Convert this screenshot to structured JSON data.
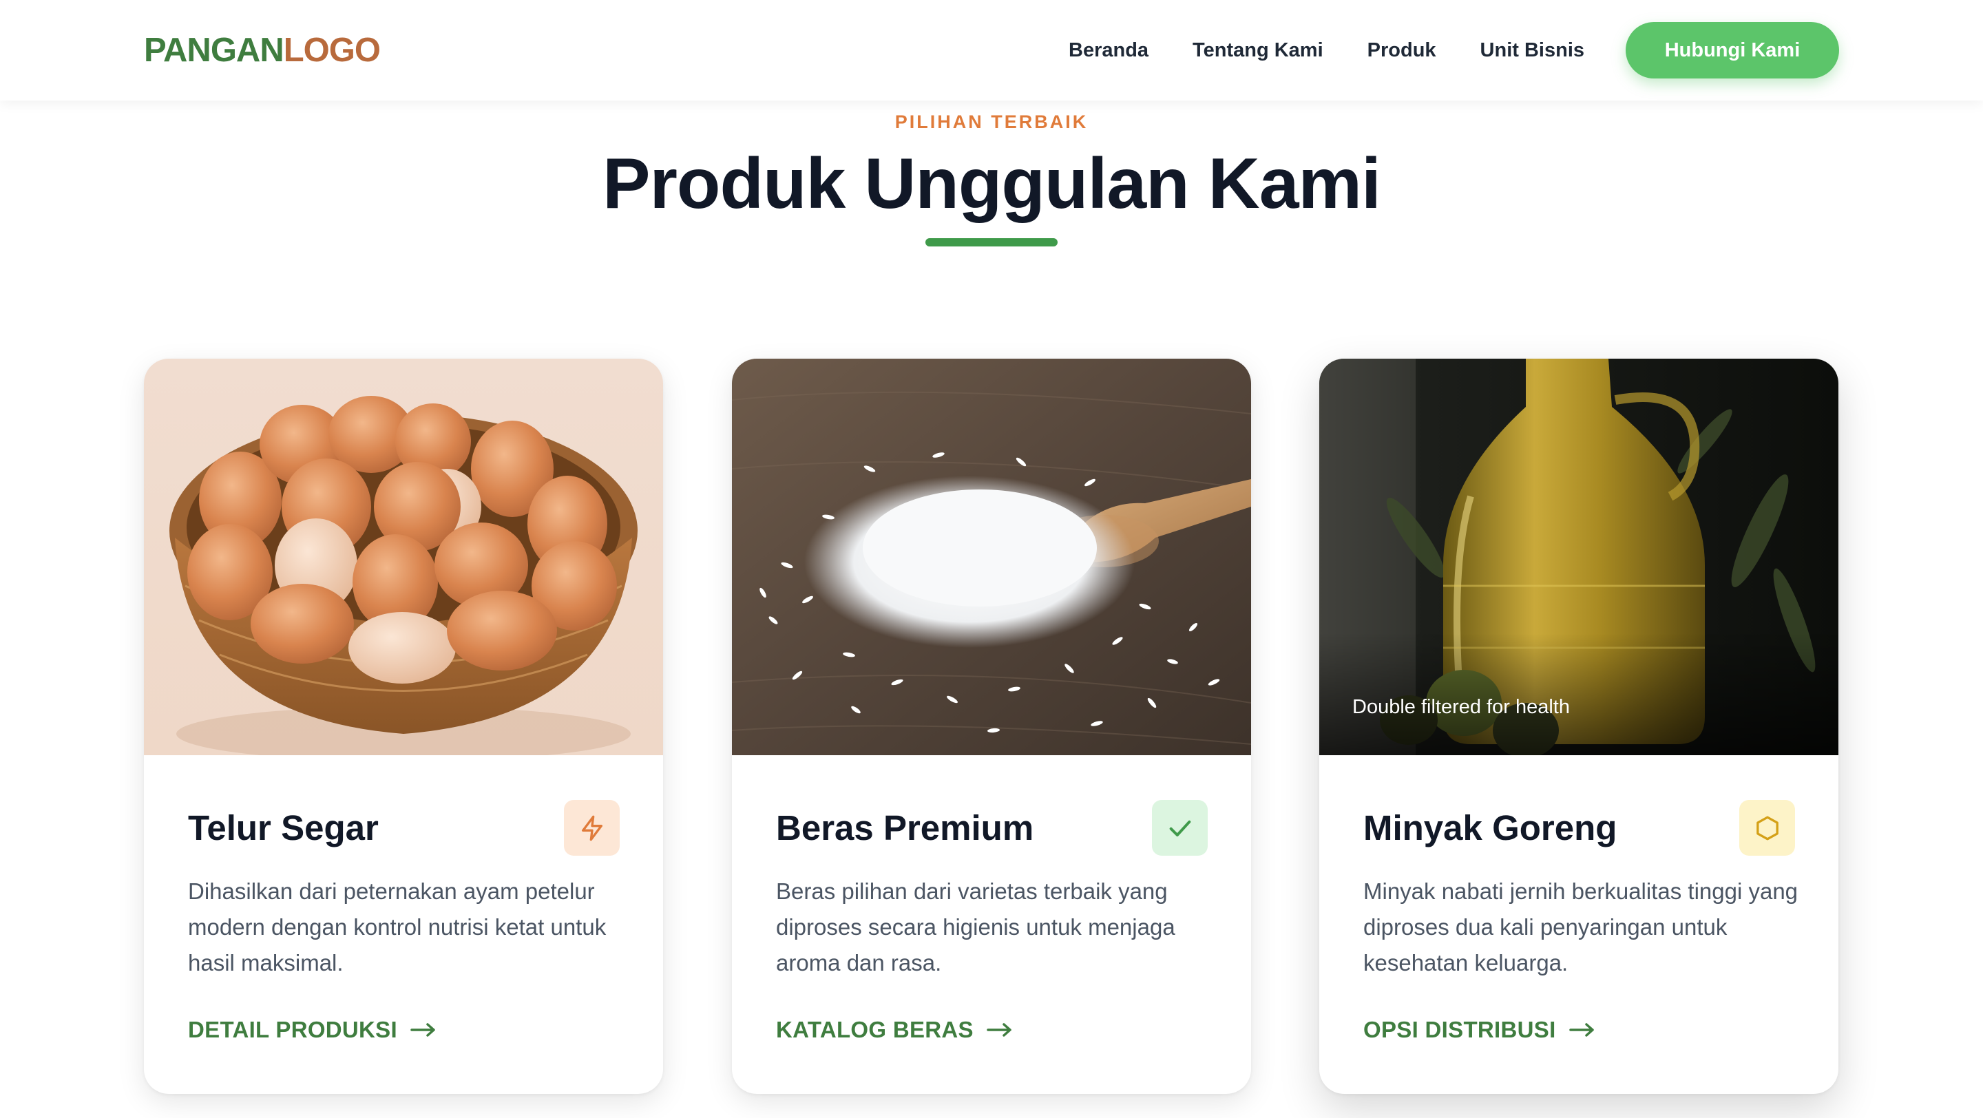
{
  "colors": {
    "brand_green": "#3f7d3f",
    "brand_brown": "#b86a3c",
    "cta_green": "#5cc56a",
    "accent_orange": "#e07b3a",
    "heading": "#111827",
    "body_text": "#4b5563"
  },
  "navbar": {
    "logo_part1": "PANGAN",
    "logo_part2": "LOGO",
    "links": [
      "Beranda",
      "Tentang Kami",
      "Produk",
      "Unit Bisnis"
    ],
    "cta_label": "Hubungi Kami"
  },
  "section": {
    "eyebrow": "PILIHAN TERBAIK",
    "title": "Produk Unggulan Kami"
  },
  "cards": [
    {
      "title": "Telur Segar",
      "icon": "lightning-icon",
      "description": "Dihasilkan dari peternakan ayam petelur modern dengan kontrol nutrisi ketat untuk hasil maksimal.",
      "link_label": "DETAIL PRODUKSI",
      "image": "egg-basket-image"
    },
    {
      "title": "Beras Premium",
      "icon": "checkmark-icon",
      "description": "Beras pilihan dari varietas terbaik yang diproses secara higienis untuk menjaga aroma dan rasa.",
      "link_label": "KATALOG BERAS",
      "image": "rice-spoon-image"
    },
    {
      "title": "Minyak Goreng",
      "icon": "hexagon-icon",
      "description": "Minyak nabati jernih berkualitas tinggi yang diproses dua kali penyaringan untuk kesehatan keluarga.",
      "link_label": "OPSI DISTRIBUSI",
      "image": "oil-bottle-image",
      "image_caption": "Double filtered for health"
    }
  ]
}
